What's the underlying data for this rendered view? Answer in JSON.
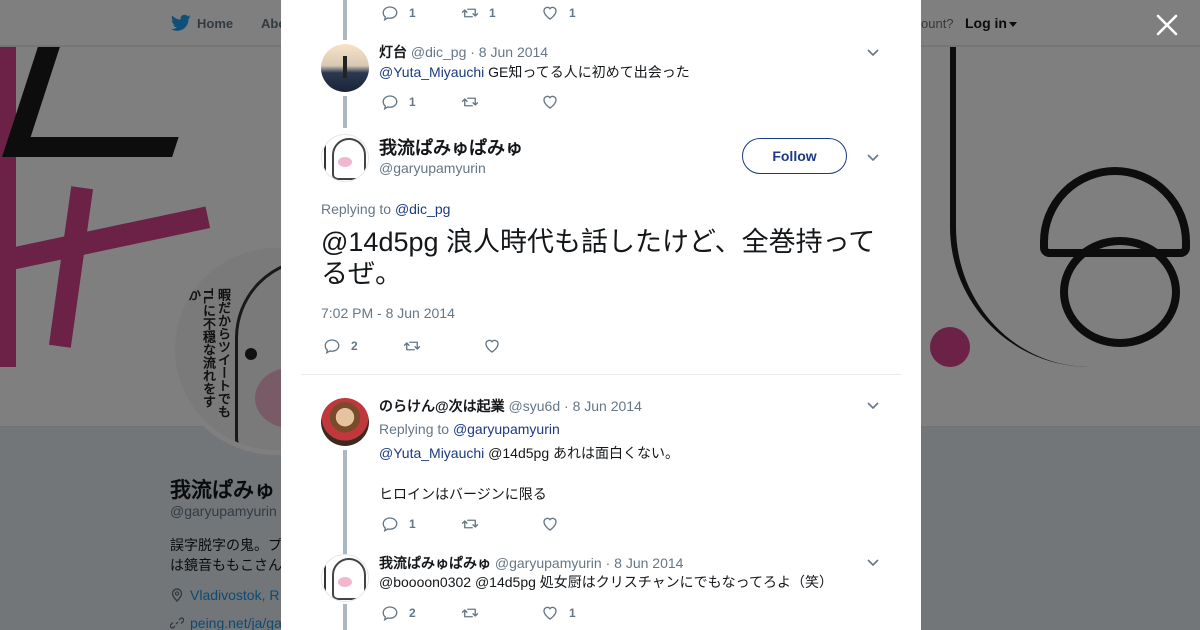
{
  "background": {
    "nav": {
      "home": "Home",
      "about": "Abo",
      "have_account": "ccount?",
      "login": "Log in"
    },
    "profile": {
      "name": "我流ぱみゅ",
      "handle": "@garyupamyurin",
      "bio_line1": "誤字脱字の鬼。プ",
      "bio_line2": "は鏡音ももこさん",
      "location": "Vladivostok, R",
      "link": "peing.net/ja/ga"
    },
    "avatar_vertical_text": "暇だからツイートでもTLに不穏な流れをすか"
  },
  "modal": {
    "tweets_above": [
      {
        "kind": "actions_only",
        "counts": {
          "reply": "1",
          "retweet": "1",
          "like": "1"
        }
      },
      {
        "name": "灯台",
        "handle": "@dic_pg",
        "date": "· 8 Jun 2014",
        "mention": "@Yuta_Miyauchi",
        "text": " GE知ってる人に初めて出会った",
        "counts": {
          "reply": "1",
          "retweet": "",
          "like": ""
        }
      }
    ],
    "main_tweet": {
      "name": "我流ぱみゅぱみゅ",
      "handle": "@garyupamyurin",
      "follow_label": "Follow",
      "replying_prefix": "Replying to ",
      "replying_to": "@dic_pg",
      "text": "@14d5pg 浪人時代も話したけど、全巻持ってるぜ。",
      "timestamp": "7:02 PM - 8 Jun 2014",
      "counts": {
        "reply": "2",
        "retweet": "",
        "like": ""
      }
    },
    "replies": [
      {
        "name": "のらけん@次は起業",
        "handle": "@syu6d",
        "date": "· 8 Jun 2014",
        "replying_prefix": "Replying to ",
        "replying_to": "@garyupamyurin",
        "mention": "@Yuta_Miyauchi",
        "text1": " @14d5pg あれは面白くない。",
        "text2": "ヒロインはバージンに限る",
        "counts": {
          "reply": "1",
          "retweet": "",
          "like": ""
        }
      },
      {
        "name": "我流ぱみゅぱみゅ",
        "handle": "@garyupamyurin",
        "date": "· 8 Jun 2014",
        "text": "@boooon0302 @14d5pg 処女厨はクリスチャンにでもなってろよ（笑）",
        "counts": {
          "reply": "2",
          "retweet": "",
          "like": "1"
        }
      }
    ]
  },
  "icons": [
    "twitter-bird-icon",
    "close-icon",
    "reply-icon",
    "retweet-icon",
    "like-icon",
    "chevron-down-icon",
    "location-pin-icon",
    "link-icon"
  ],
  "colors": {
    "accent": "#1b95e0",
    "mention": "#1b3a80",
    "muted": "#657786",
    "thread": "#aab8c2"
  }
}
